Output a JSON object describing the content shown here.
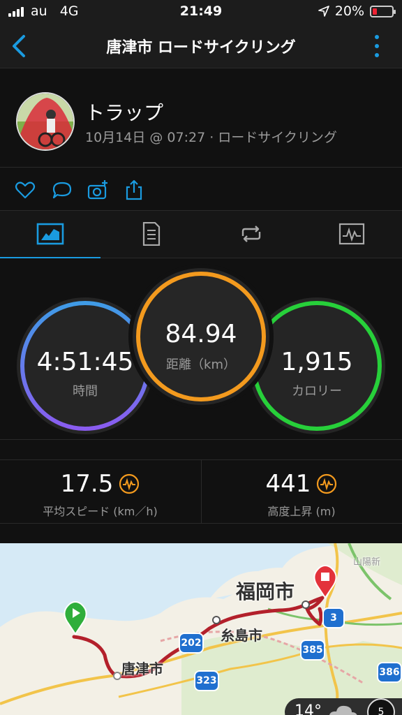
{
  "status_bar": {
    "carrier": "au",
    "network": "4G",
    "time": "21:49",
    "battery": "20%",
    "battery_level": 0.2
  },
  "header": {
    "title": "唐津市 ロードサイクリング"
  },
  "activity": {
    "user_name": "トラップ",
    "meta": "10月14日 @ 07:27 · ロードサイクリング"
  },
  "metrics": {
    "time": {
      "value": "4:51:45",
      "label": "時間"
    },
    "distance": {
      "value": "84.94",
      "label": "距離（km）"
    },
    "calories": {
      "value": "1,915",
      "label": "カロリー"
    }
  },
  "stats": {
    "avg_speed": {
      "value": "17.5",
      "label": "平均スピード (km／h)"
    },
    "elevation": {
      "value": "441",
      "label": "高度上昇 (m)"
    }
  },
  "map": {
    "labels": {
      "fukuoka": "福岡市",
      "itoshima": "糸島市",
      "karatsu": "唐津市",
      "expressway": "山陽新"
    },
    "route_shields": [
      "202",
      "323",
      "3",
      "385",
      "386"
    ],
    "weather_temp": "14°",
    "wind": "5"
  },
  "colors": {
    "accent": "#1a9be0",
    "ring_time_start": "#3f9be6",
    "ring_time_end": "#8a5cf0",
    "ring_distance": "#f39a1e",
    "ring_calories": "#27d03a",
    "route": "#b3202b",
    "start_pin": "#2fae3b",
    "end_pin": "#e3323b"
  }
}
